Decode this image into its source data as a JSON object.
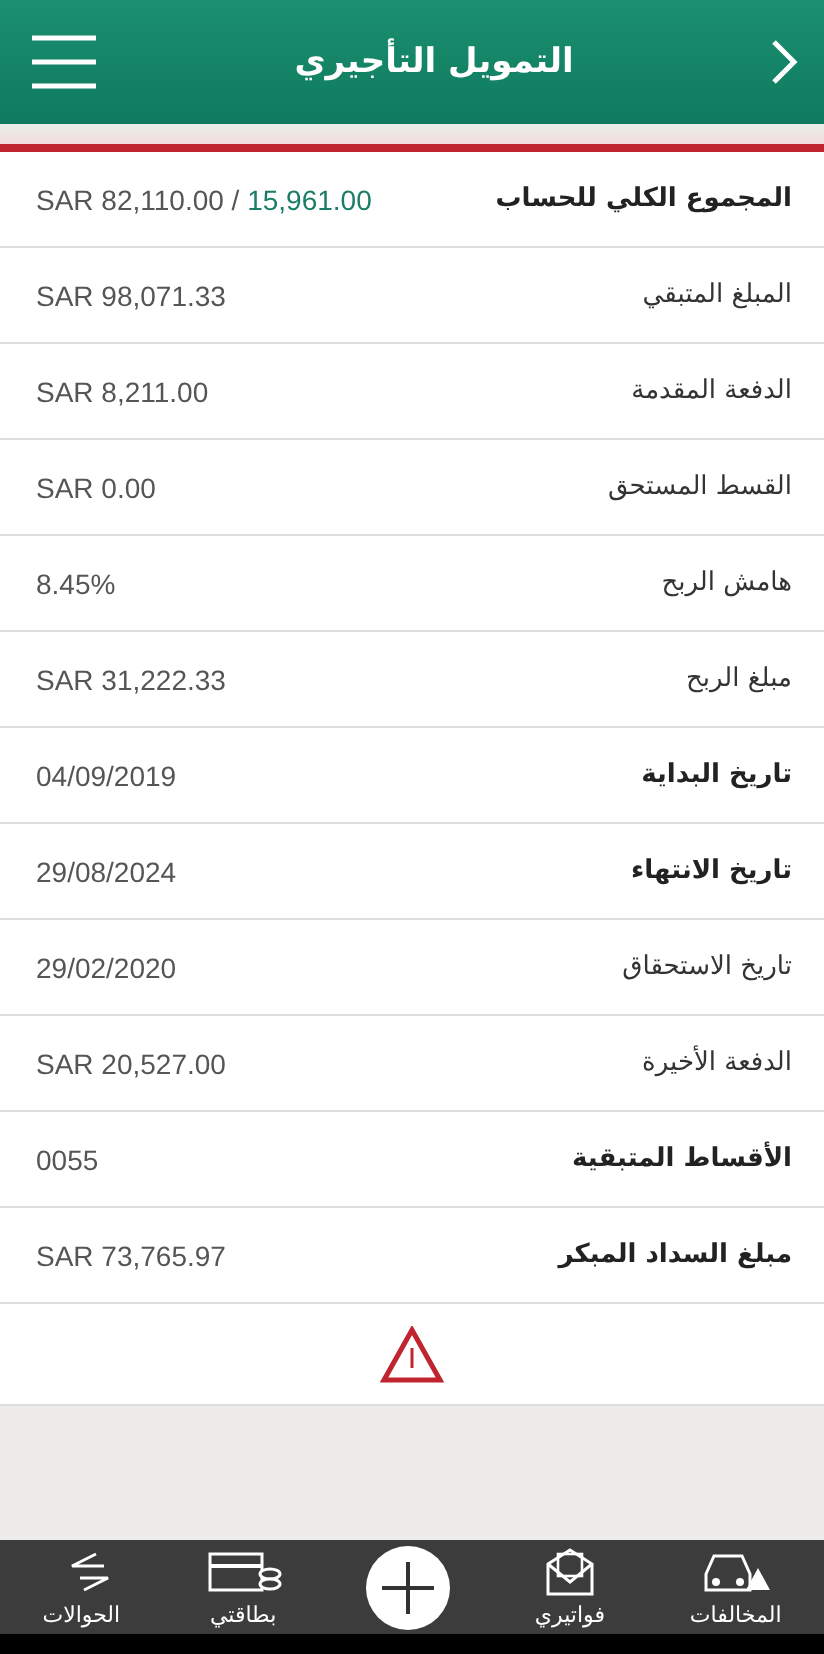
{
  "header": {
    "title": "التمويل التأجيري"
  },
  "total": {
    "label": "المجموع الكلي للحساب",
    "value": "SAR 82,110.00 /",
    "highlight": "15,961.00"
  },
  "rows": [
    {
      "label": "المبلغ المتبقي",
      "value": "SAR 98,071.33",
      "bold": false
    },
    {
      "label": "الدفعة المقدمة",
      "value": "SAR 8,211.00",
      "bold": false
    },
    {
      "label": "القسط المستحق",
      "value": "SAR 0.00",
      "bold": false
    },
    {
      "label": "هامش الربح",
      "value": "8.45%",
      "bold": false
    },
    {
      "label": "مبلغ الربح",
      "value": "SAR 31,222.33",
      "bold": false
    },
    {
      "label": "تاريخ البداية",
      "value": "04/09/2019",
      "bold": true
    },
    {
      "label": "تاريخ الانتهاء",
      "value": "29/08/2024",
      "bold": true
    },
    {
      "label": "تاريخ الاستحقاق",
      "value": "29/02/2020",
      "bold": false
    },
    {
      "label": "الدفعة الأخيرة",
      "value": "SAR 20,527.00",
      "bold": false
    },
    {
      "label": "الأقساط المتبقية",
      "value": "0055",
      "bold": true
    },
    {
      "label": "مبلغ السداد المبكر",
      "value": "SAR 73,765.97",
      "bold": true
    }
  ],
  "bottom_nav": [
    {
      "kind": "car",
      "label": "المخالفات"
    },
    {
      "kind": "bill",
      "label": "فواتيري"
    },
    {
      "kind": "add"
    },
    {
      "kind": "card",
      "label": "بطاقتي"
    },
    {
      "kind": "transfer",
      "label": "الحوالات"
    }
  ]
}
